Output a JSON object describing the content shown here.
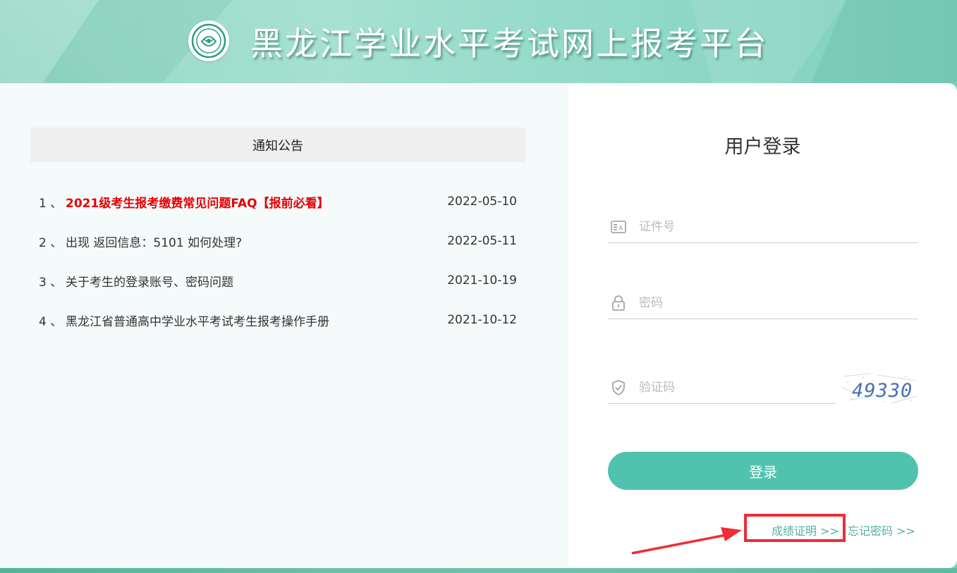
{
  "header": {
    "site_title": "黑龙江学业水平考试网上报考平台",
    "logo_icon": "exam-emblem-icon"
  },
  "notices": {
    "heading": "通知公告",
    "items": [
      {
        "index": "1 、",
        "title": "2021级考生报考缴费常见问题FAQ【报前必看】",
        "date": "2022-05-10",
        "hot": true
      },
      {
        "index": "2 、",
        "title": "出现 返回信息：5101 如何处理?",
        "date": "2022-05-11",
        "hot": false
      },
      {
        "index": "3 、",
        "title": "关于考生的登录账号、密码问题",
        "date": "2021-10-19",
        "hot": false
      },
      {
        "index": "4 、",
        "title": "黑龙江省普通高中学业水平考试考生报考操作手册",
        "date": "2021-10-12",
        "hot": false
      }
    ]
  },
  "login": {
    "title": "用户登录",
    "id_placeholder": "证件号",
    "password_placeholder": "密码",
    "captcha_placeholder": "验证码",
    "captcha_text": "49330",
    "submit_label": "登录",
    "score_cert_link": "成绩证明 >>",
    "forgot_link": "忘记密码 >>"
  },
  "colors": {
    "accent": "#50c3ae",
    "link": "#4fb3a4",
    "hot_notice": "#e50000",
    "annotation": "#ef2d35"
  }
}
